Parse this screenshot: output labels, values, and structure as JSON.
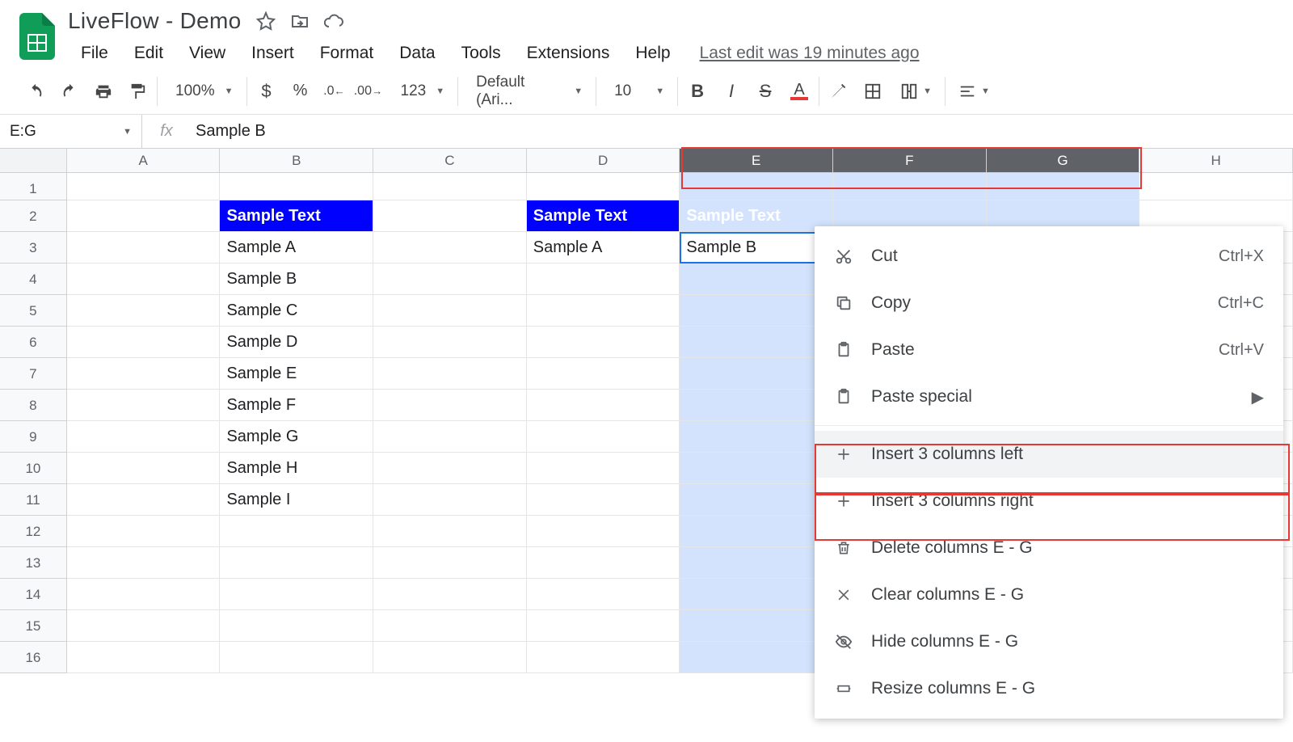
{
  "doc": {
    "title": "LiveFlow - Demo"
  },
  "menubar": {
    "items": [
      "File",
      "Edit",
      "View",
      "Insert",
      "Format",
      "Data",
      "Tools",
      "Extensions",
      "Help"
    ],
    "last_edit": "Last edit was 19 minutes ago"
  },
  "toolbar": {
    "zoom": "100%",
    "font": "Default (Ari...",
    "font_size": "10",
    "number_format": "123"
  },
  "formula_bar": {
    "namebox": "E:G",
    "fx": "fx",
    "value": "Sample B"
  },
  "columns": [
    "A",
    "B",
    "C",
    "D",
    "E",
    "F",
    "G",
    "H"
  ],
  "selected_cols": [
    "E",
    "F",
    "G"
  ],
  "row_headers": [
    "1",
    "2",
    "3",
    "4",
    "5",
    "6",
    "7",
    "8",
    "9",
    "10",
    "11",
    "12",
    "13",
    "14",
    "15",
    "16"
  ],
  "cells": {
    "B2": {
      "text": "Sample Text",
      "hdr": true
    },
    "D2": {
      "text": "Sample Text",
      "hdr": true
    },
    "E2": {
      "text": "Sample Text",
      "hdr": true
    },
    "B3": {
      "text": "Sample A"
    },
    "D3": {
      "text": "Sample A"
    },
    "E3": {
      "text": "Sample B"
    },
    "B4": {
      "text": "Sample B"
    },
    "B5": {
      "text": "Sample C"
    },
    "B6": {
      "text": "Sample D"
    },
    "B7": {
      "text": "Sample E"
    },
    "B8": {
      "text": "Sample F"
    },
    "B9": {
      "text": "Sample G"
    },
    "B10": {
      "text": "Sample H"
    },
    "B11": {
      "text": "Sample I"
    }
  },
  "context_menu": {
    "cut": "Cut",
    "cut_k": "Ctrl+X",
    "copy": "Copy",
    "copy_k": "Ctrl+C",
    "paste": "Paste",
    "paste_k": "Ctrl+V",
    "paste_special": "Paste special",
    "ins_left": "Insert 3 columns left",
    "ins_right": "Insert 3 columns right",
    "delete": "Delete columns E - G",
    "clear": "Clear columns E - G",
    "hide": "Hide columns E - G",
    "resize": "Resize columns E - G"
  }
}
